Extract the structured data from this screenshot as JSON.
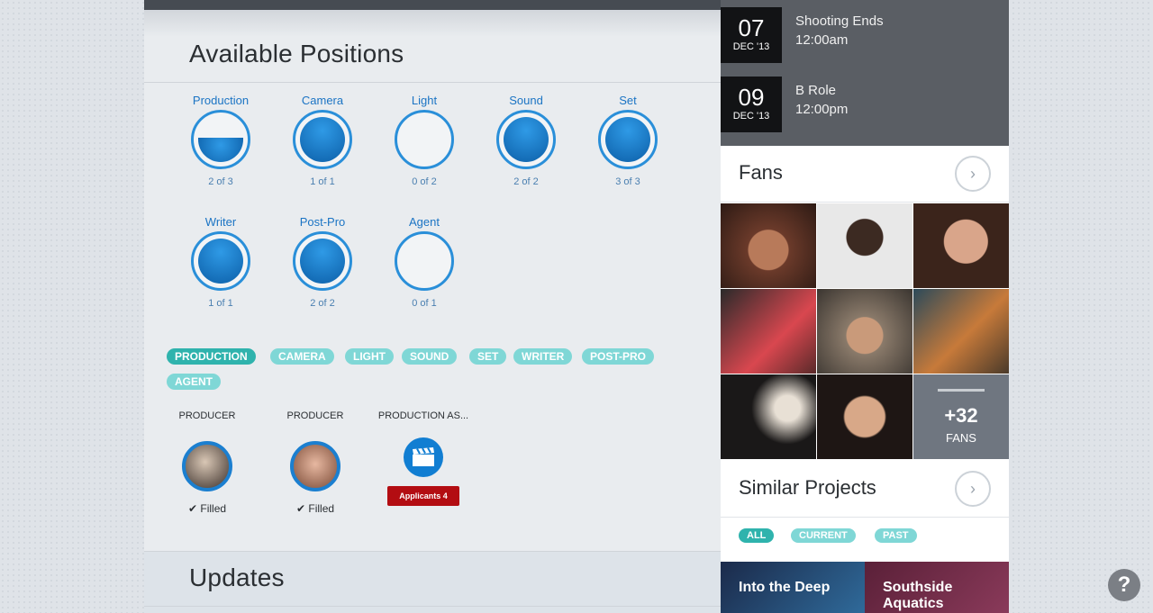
{
  "available_positions": {
    "title": "Available Positions",
    "positions": [
      {
        "label": "Production",
        "count": "2 of 3",
        "fill": 0.67
      },
      {
        "label": "Camera",
        "count": "1 of 1",
        "fill": 1
      },
      {
        "label": "Light",
        "count": "0 of 2",
        "fill": 0
      },
      {
        "label": "Sound",
        "count": "2 of 2",
        "fill": 1
      },
      {
        "label": "Set",
        "count": "3 of 3",
        "fill": 1
      },
      {
        "label": "Writer",
        "count": "1 of 1",
        "fill": 1
      },
      {
        "label": "Post-Pro",
        "count": "2 of 2",
        "fill": 1
      },
      {
        "label": "Agent",
        "count": "0 of 1",
        "fill": 0
      }
    ],
    "filter_tags": [
      "PRODUCTION",
      "CAMERA",
      "LIGHT",
      "SOUND",
      "SET",
      "WRITER",
      "POST-PRO",
      "AGENT"
    ],
    "active_tag": "PRODUCTION",
    "roles": [
      {
        "title": "PRODUCER",
        "status": "Filled"
      },
      {
        "title": "PRODUCER",
        "status": "Filled"
      },
      {
        "title": "PRODUCTION AS...",
        "button": "Applicants 4"
      }
    ]
  },
  "updates": {
    "title": "Updates"
  },
  "schedule": [
    {
      "day": "07",
      "month": "DEC '13",
      "title": "Shooting Ends",
      "time": "12:00am"
    },
    {
      "day": "09",
      "month": "DEC '13",
      "title": "B Role",
      "time": "12:00pm"
    }
  ],
  "fans": {
    "title": "Fans",
    "more_count": "+32",
    "more_label": "FANS"
  },
  "similar": {
    "title": "Similar Projects",
    "tags": [
      "ALL",
      "CURRENT",
      "PAST"
    ],
    "projects": [
      "Into the Deep",
      "Southside Aquatics"
    ]
  },
  "help": "?",
  "colors": {
    "accent": "#2a8fd9",
    "tag": "#7fd7d6",
    "tag_active": "#2fb3ad",
    "applicants": "#b30d12"
  }
}
